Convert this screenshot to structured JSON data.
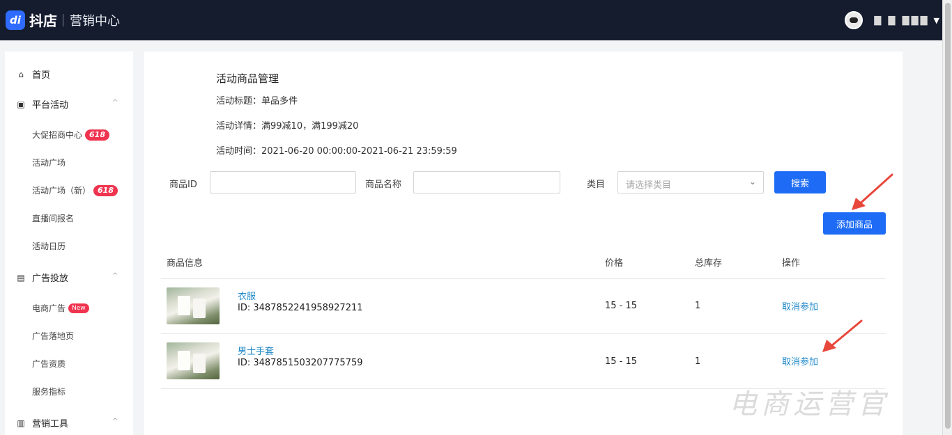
{
  "header": {
    "logo_mark": "di",
    "logo_text": "抖店",
    "subtitle": "营销中心",
    "user_name": "▇ ▇ ▇▇▇",
    "caret": "▼"
  },
  "sidebar": {
    "home": "首页",
    "platform_activity": "平台活动",
    "items_platform": [
      {
        "label": "大促招商中心",
        "badge": "618"
      },
      {
        "label": "活动广场",
        "badge": ""
      },
      {
        "label": "活动广场（新）",
        "badge": "618"
      },
      {
        "label": "直播间报名",
        "badge": ""
      },
      {
        "label": "活动日历",
        "badge": ""
      }
    ],
    "ads": "广告投放",
    "items_ads": [
      {
        "label": "电商广告",
        "badge": "New"
      },
      {
        "label": "广告落地页",
        "badge": ""
      },
      {
        "label": "广告资质",
        "badge": ""
      },
      {
        "label": "服务指标",
        "badge": ""
      }
    ],
    "marketing_tools": "营销工具",
    "collapse_icon": "^"
  },
  "main": {
    "title": "活动商品管理",
    "activity_title": "活动标题：单品多件",
    "activity_detail": "活动详情：满99减10，满199减20",
    "activity_time": "活动时间：2021-06-20 00:00:00-2021-06-21 23:59:59",
    "filters": {
      "product_id_label": "商品ID",
      "product_name_label": "商品名称",
      "category_label": "类目",
      "category_placeholder": "请选择类目",
      "search_button": "搜索"
    },
    "add_product_button": "添加商品",
    "table": {
      "headers": [
        "商品信息",
        "价格",
        "总库存",
        "操作"
      ],
      "rows": [
        {
          "name": "衣服",
          "id": "ID: 3487852241958927211",
          "price": "15 - 15",
          "stock": "1",
          "action": "取消参加"
        },
        {
          "name": "男士手套",
          "id": "ID: 3487851503207775759",
          "price": "15 - 15",
          "stock": "1",
          "action": "取消参加"
        }
      ]
    }
  },
  "watermark": "电商运营官",
  "colors": {
    "header_bg": "#141c2e",
    "primary": "#1e6cf5",
    "link": "#1e88c8",
    "badge": "#f0344f",
    "arrow": "#e8473b"
  }
}
